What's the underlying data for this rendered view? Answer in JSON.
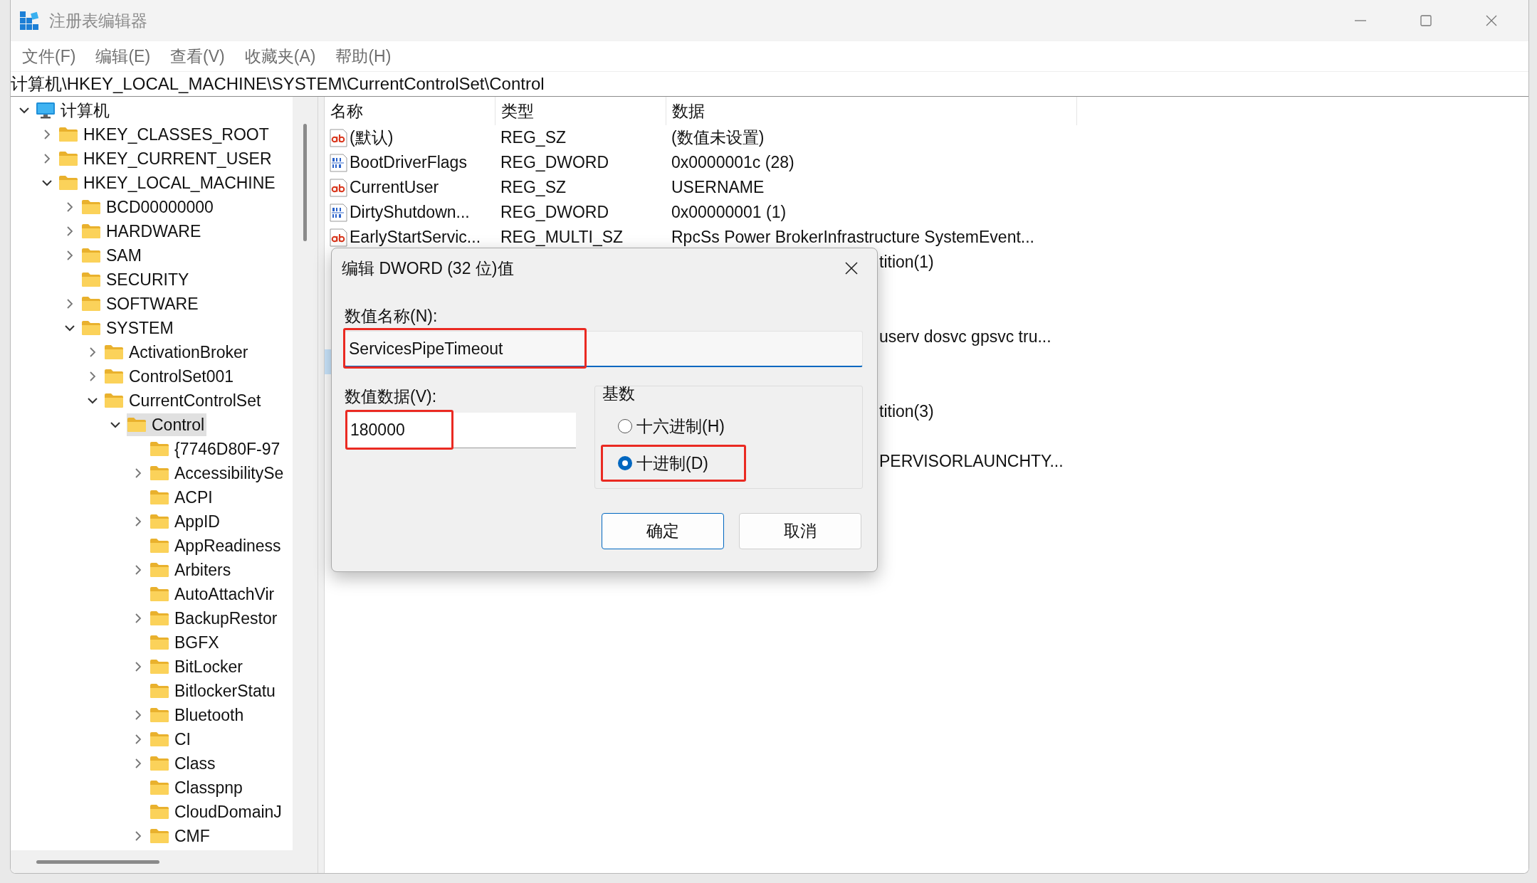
{
  "window": {
    "title": "注册表编辑器"
  },
  "menu": [
    "文件(F)",
    "编辑(E)",
    "查看(V)",
    "收藏夹(A)",
    "帮助(H)"
  ],
  "address": "计算机\\HKEY_LOCAL_MACHINE\\SYSTEM\\CurrentControlSet\\Control",
  "tree": [
    {
      "label": "计算机",
      "kind": "root",
      "expandable": true,
      "expanded": true,
      "selected": false,
      "children": [
        {
          "label": "HKEY_CLASSES_ROOT",
          "kind": "key",
          "expandable": true,
          "expanded": false,
          "selected": false
        },
        {
          "label": "HKEY_CURRENT_USER",
          "kind": "key",
          "expandable": true,
          "expanded": false,
          "selected": false
        },
        {
          "label": "HKEY_LOCAL_MACHINE",
          "kind": "key",
          "expandable": true,
          "expanded": true,
          "selected": false,
          "children": [
            {
              "label": "BCD00000000",
              "kind": "key",
              "expandable": true,
              "expanded": false,
              "selected": false
            },
            {
              "label": "HARDWARE",
              "kind": "key",
              "expandable": true,
              "expanded": false,
              "selected": false
            },
            {
              "label": "SAM",
              "kind": "key",
              "expandable": true,
              "expanded": false,
              "selected": false
            },
            {
              "label": "SECURITY",
              "kind": "key",
              "expandable": false,
              "selected": false
            },
            {
              "label": "SOFTWARE",
              "kind": "key",
              "expandable": true,
              "expanded": false,
              "selected": false
            },
            {
              "label": "SYSTEM",
              "kind": "key",
              "expandable": true,
              "expanded": true,
              "selected": false,
              "children": [
                {
                  "label": "ActivationBroker",
                  "kind": "key",
                  "expandable": true,
                  "expanded": false,
                  "selected": false
                },
                {
                  "label": "ControlSet001",
                  "kind": "key",
                  "expandable": true,
                  "expanded": false,
                  "selected": false
                },
                {
                  "label": "CurrentControlSet",
                  "kind": "key",
                  "expandable": true,
                  "expanded": true,
                  "selected": false,
                  "children": [
                    {
                      "label": "Control",
                      "kind": "key",
                      "expandable": true,
                      "expanded": true,
                      "selected": true,
                      "children": [
                        {
                          "label": "{7746D80F-97",
                          "kind": "key",
                          "expandable": false,
                          "selected": false
                        },
                        {
                          "label": "AccessibilitySe",
                          "kind": "key",
                          "expandable": true,
                          "expanded": false,
                          "selected": false
                        },
                        {
                          "label": "ACPI",
                          "kind": "key",
                          "expandable": false,
                          "selected": false
                        },
                        {
                          "label": "AppID",
                          "kind": "key",
                          "expandable": true,
                          "expanded": false,
                          "selected": false
                        },
                        {
                          "label": "AppReadiness",
                          "kind": "key",
                          "expandable": false,
                          "selected": false
                        },
                        {
                          "label": "Arbiters",
                          "kind": "key",
                          "expandable": true,
                          "expanded": false,
                          "selected": false
                        },
                        {
                          "label": "AutoAttachVir",
                          "kind": "key",
                          "expandable": false,
                          "selected": false
                        },
                        {
                          "label": "BackupRestor",
                          "kind": "key",
                          "expandable": true,
                          "expanded": false,
                          "selected": false
                        },
                        {
                          "label": "BGFX",
                          "kind": "key",
                          "expandable": false,
                          "selected": false
                        },
                        {
                          "label": "BitLocker",
                          "kind": "key",
                          "expandable": true,
                          "expanded": false,
                          "selected": false
                        },
                        {
                          "label": "BitlockerStatu",
                          "kind": "key",
                          "expandable": false,
                          "selected": false
                        },
                        {
                          "label": "Bluetooth",
                          "kind": "key",
                          "expandable": true,
                          "expanded": false,
                          "selected": false
                        },
                        {
                          "label": "CI",
                          "kind": "key",
                          "expandable": true,
                          "expanded": false,
                          "selected": false
                        },
                        {
                          "label": "Class",
                          "kind": "key",
                          "expandable": true,
                          "expanded": false,
                          "selected": false
                        },
                        {
                          "label": "Classpnp",
                          "kind": "key",
                          "expandable": false,
                          "selected": false
                        },
                        {
                          "label": "CloudDomainJ",
                          "kind": "key",
                          "expandable": false,
                          "selected": false
                        },
                        {
                          "label": "CMF",
                          "kind": "key",
                          "expandable": true,
                          "expanded": false,
                          "selected": false
                        }
                      ]
                    }
                  ]
                }
              ]
            }
          ]
        }
      ]
    }
  ],
  "list": {
    "columns": [
      "名称",
      "类型",
      "数据"
    ],
    "rows": [
      {
        "kind": "string",
        "name": "(默认)",
        "type": "REG_SZ",
        "data": "(数值未设置)",
        "selected": false
      },
      {
        "kind": "binary",
        "name": "BootDriverFlags",
        "type": "REG_DWORD",
        "data": "0x0000001c (28)",
        "selected": false
      },
      {
        "kind": "string",
        "name": "CurrentUser",
        "type": "REG_SZ",
        "data": "USERNAME",
        "selected": false
      },
      {
        "kind": "binary",
        "name": "DirtyShutdown...",
        "type": "REG_DWORD",
        "data": "0x00000001 (1)",
        "selected": false
      },
      {
        "kind": "string",
        "name": "EarlyStartServic...",
        "type": "REG_MULTI_SZ",
        "data": "RpcSs Power BrokerInfrastructure SystemEvent...",
        "selected": false
      },
      {
        "kind": "partial",
        "data": "tition(1)",
        "selected": false
      },
      {
        "kind": "covered",
        "selected": false
      },
      {
        "kind": "covered",
        "selected": false
      },
      {
        "kind": "partial",
        "data": "userv dosvc gpsvc tru...",
        "selected": false
      },
      {
        "kind": "covered",
        "selected": true
      },
      {
        "kind": "covered",
        "selected": false
      },
      {
        "kind": "partial",
        "data": "tition(3)",
        "selected": false
      },
      {
        "kind": "covered",
        "selected": false
      },
      {
        "kind": "partial",
        "data": "PERVISORLAUNCHTY...",
        "selected": false
      }
    ]
  },
  "dialog": {
    "title": "编辑 DWORD (32 位)值",
    "name_label": "数值名称(N):",
    "name_value": "ServicesPipeTimeout",
    "name_highlighted": true,
    "data_label": "数值数据(V):",
    "data_value": "180000",
    "data_highlighted": true,
    "base_label": "基数",
    "bases": [
      {
        "label": "十六进制(H)",
        "selected": false,
        "highlighted": false
      },
      {
        "label": "十进制(D)",
        "selected": true,
        "highlighted": true
      }
    ],
    "buttons": [
      {
        "label": "确定",
        "default": true
      },
      {
        "label": "取消",
        "default": false
      }
    ]
  }
}
